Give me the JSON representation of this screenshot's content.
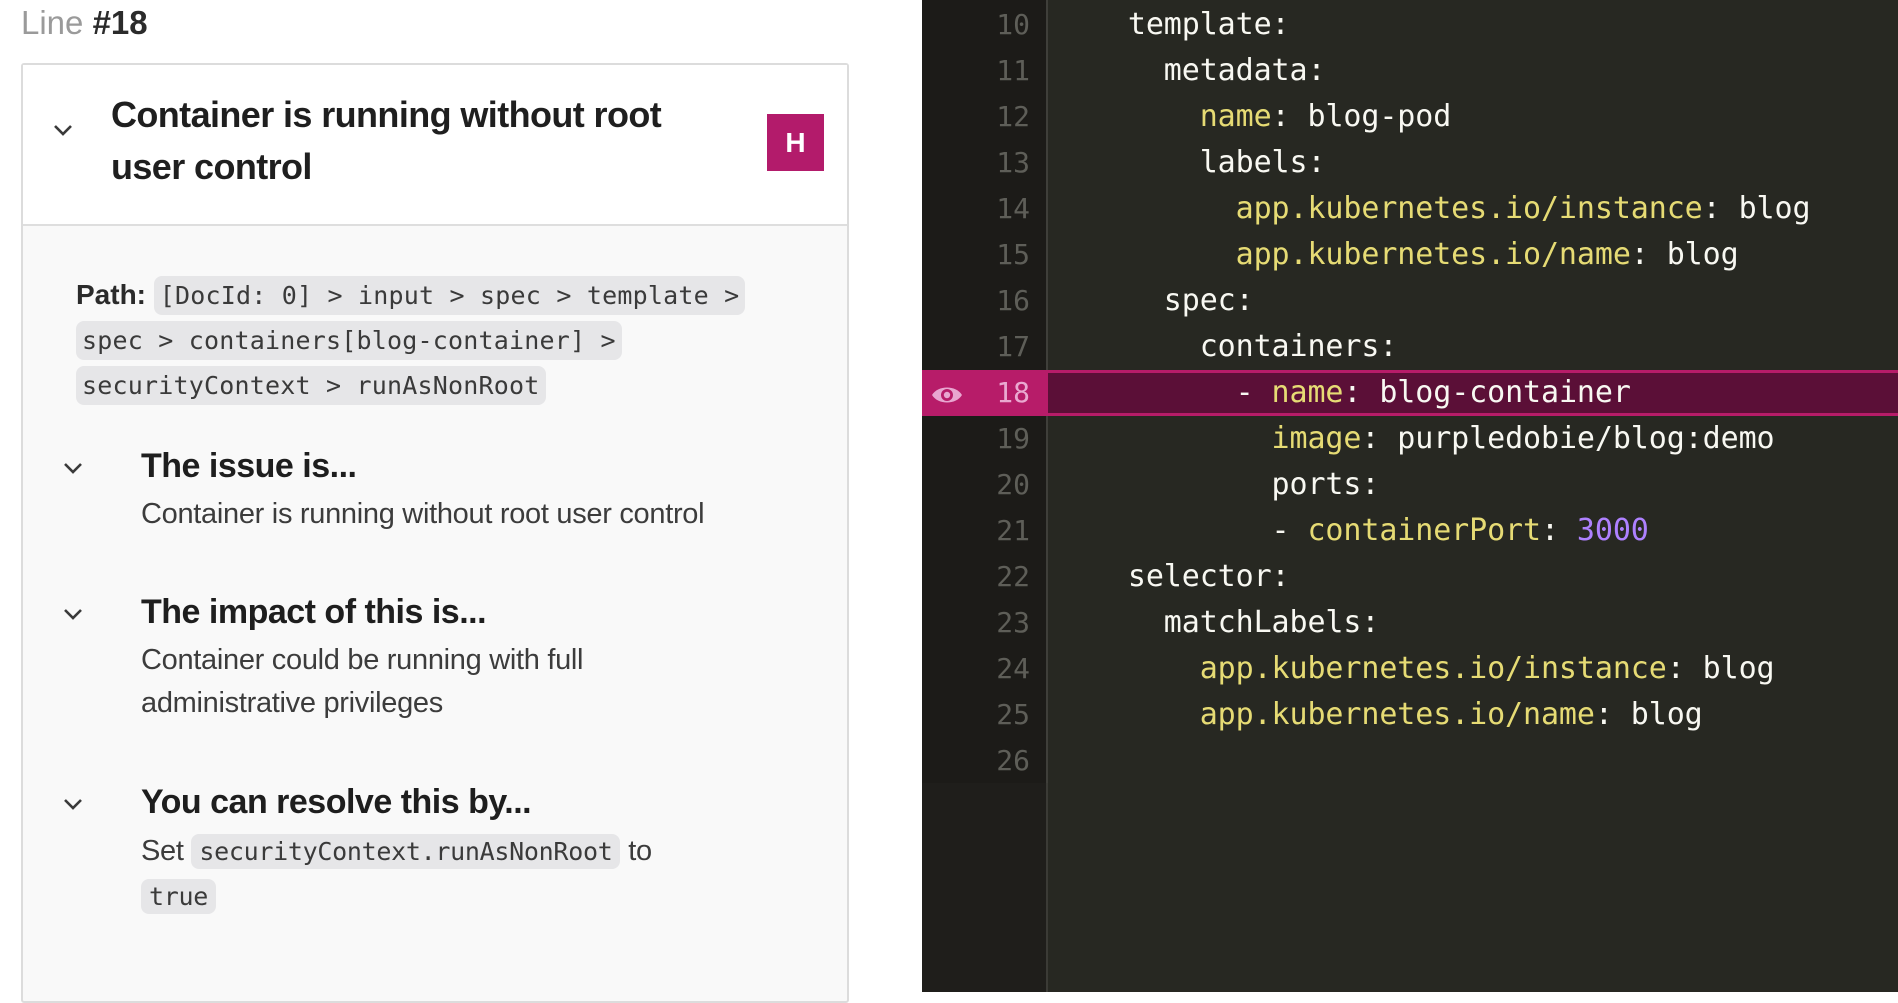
{
  "panel": {
    "line_prefix": "Line",
    "line_number": "#18",
    "issue": {
      "title": "Container is running without root user control",
      "severity_badge": "H",
      "severity_color": "#b31b6b",
      "path_label": "Path:",
      "path": "[DocId: 0] > input > spec > template > spec > containers[blog-container] > securityContext > runAsNonRoot",
      "sections": [
        {
          "heading": "The issue is...",
          "body": "Container is running without root user control"
        },
        {
          "heading": "The impact of this is...",
          "body": "Container could be running with full administrative privileges"
        },
        {
          "heading": "You can resolve this by...",
          "body_prefix": "Set",
          "body_code": "securityContext.runAsNonRoot",
          "body_mid": "to",
          "body_code2": "true"
        }
      ]
    }
  },
  "editor": {
    "highlight_color": "#b71c69",
    "highlighted_line": 18,
    "lines": [
      {
        "num": "10",
        "indent": "    ",
        "key": "",
        "plain": "template:",
        "sep": "",
        "value": "",
        "number": ""
      },
      {
        "num": "11",
        "indent": "      ",
        "key": "",
        "plain": "metadata:",
        "sep": "",
        "value": "",
        "number": ""
      },
      {
        "num": "12",
        "indent": "        ",
        "key": "name",
        "plain": "",
        "sep": ": ",
        "value": "blog-pod",
        "number": ""
      },
      {
        "num": "13",
        "indent": "        ",
        "key": "",
        "plain": "labels:",
        "sep": "",
        "value": "",
        "number": ""
      },
      {
        "num": "14",
        "indent": "          ",
        "key": "app.kubernetes.io/instance",
        "plain": "",
        "sep": ": ",
        "value": "blog",
        "number": ""
      },
      {
        "num": "15",
        "indent": "          ",
        "key": "app.kubernetes.io/name",
        "plain": "",
        "sep": ": ",
        "value": "blog",
        "number": ""
      },
      {
        "num": "16",
        "indent": "      ",
        "key": "",
        "plain": "spec:",
        "sep": "",
        "value": "",
        "number": ""
      },
      {
        "num": "17",
        "indent": "        ",
        "key": "",
        "plain": "containers:",
        "sep": "",
        "value": "",
        "number": ""
      },
      {
        "num": "18",
        "indent": "          - ",
        "key": "name",
        "plain": "",
        "sep": ": ",
        "value": "blog-container",
        "number": ""
      },
      {
        "num": "19",
        "indent": "            ",
        "key": "image",
        "plain": "",
        "sep": ": ",
        "value": "purpledobie/blog:demo",
        "number": ""
      },
      {
        "num": "20",
        "indent": "            ",
        "key": "",
        "plain": "ports:",
        "sep": "",
        "value": "",
        "number": ""
      },
      {
        "num": "21",
        "indent": "            - ",
        "key": "containerPort",
        "plain": "",
        "sep": ": ",
        "value": "",
        "number": "3000"
      },
      {
        "num": "22",
        "indent": "    ",
        "key": "",
        "plain": "selector:",
        "sep": "",
        "value": "",
        "number": ""
      },
      {
        "num": "23",
        "indent": "      ",
        "key": "",
        "plain": "matchLabels:",
        "sep": "",
        "value": "",
        "number": ""
      },
      {
        "num": "24",
        "indent": "        ",
        "key": "app.kubernetes.io/instance",
        "plain": "",
        "sep": ": ",
        "value": "blog",
        "number": ""
      },
      {
        "num": "25",
        "indent": "        ",
        "key": "app.kubernetes.io/name",
        "plain": "",
        "sep": ": ",
        "value": "blog",
        "number": ""
      },
      {
        "num": "26",
        "indent": "",
        "key": "",
        "plain": "",
        "sep": "",
        "value": "",
        "number": ""
      }
    ]
  }
}
